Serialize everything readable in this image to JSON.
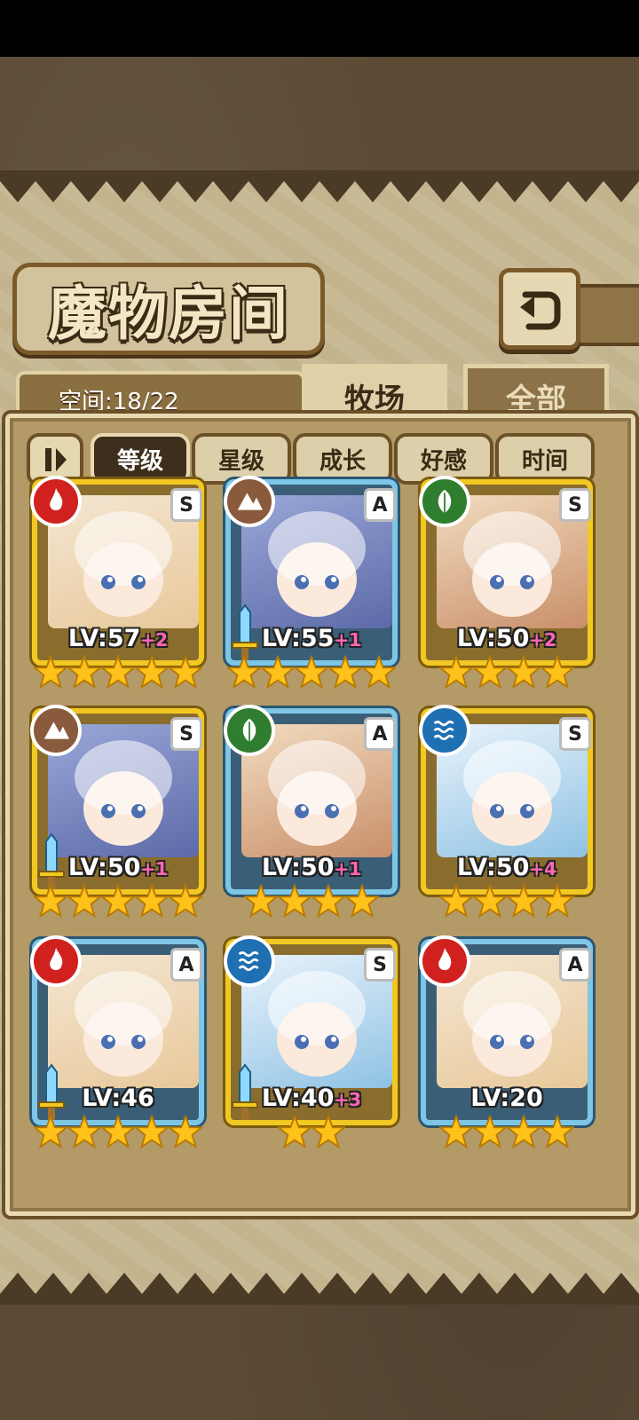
{
  "title": "魔物房间",
  "capacity_text": "空间:18/22",
  "tabs": [
    {
      "label": "牧场",
      "active": true
    },
    {
      "label": "全部",
      "active": false
    }
  ],
  "sort_buttons": [
    {
      "label": "等级",
      "active": true
    },
    {
      "label": "星级",
      "active": false
    },
    {
      "label": "成长",
      "active": false
    },
    {
      "label": "好感",
      "active": false
    },
    {
      "label": "时间",
      "active": false
    }
  ],
  "monsters": [
    {
      "level": "LV:57",
      "bonus": "+2",
      "stars": 5,
      "rank": "S",
      "element": "fire",
      "frame": "gold",
      "weapon": false
    },
    {
      "level": "LV:55",
      "bonus": "+1",
      "stars": 5,
      "rank": "A",
      "element": "earth",
      "frame": "blue",
      "weapon": true
    },
    {
      "level": "LV:50",
      "bonus": "+2",
      "stars": 4,
      "rank": "S",
      "element": "nature",
      "frame": "gold",
      "weapon": false
    },
    {
      "level": "LV:50",
      "bonus": "+1",
      "stars": 5,
      "rank": "S",
      "element": "earth",
      "frame": "gold",
      "weapon": true
    },
    {
      "level": "LV:50",
      "bonus": "+1",
      "stars": 4,
      "rank": "A",
      "element": "nature",
      "frame": "blue",
      "weapon": false
    },
    {
      "level": "LV:50",
      "bonus": "+4",
      "stars": 4,
      "rank": "S",
      "element": "water",
      "frame": "gold",
      "weapon": false
    },
    {
      "level": "LV:46",
      "bonus": "",
      "stars": 5,
      "rank": "A",
      "element": "fire",
      "frame": "blue",
      "weapon": true
    },
    {
      "level": "LV:40",
      "bonus": "+3",
      "stars": 2,
      "rank": "S",
      "element": "water",
      "frame": "gold",
      "weapon": true
    },
    {
      "level": "LV:20",
      "bonus": "",
      "stars": 4,
      "rank": "A",
      "element": "fire",
      "frame": "blue",
      "weapon": false
    }
  ]
}
